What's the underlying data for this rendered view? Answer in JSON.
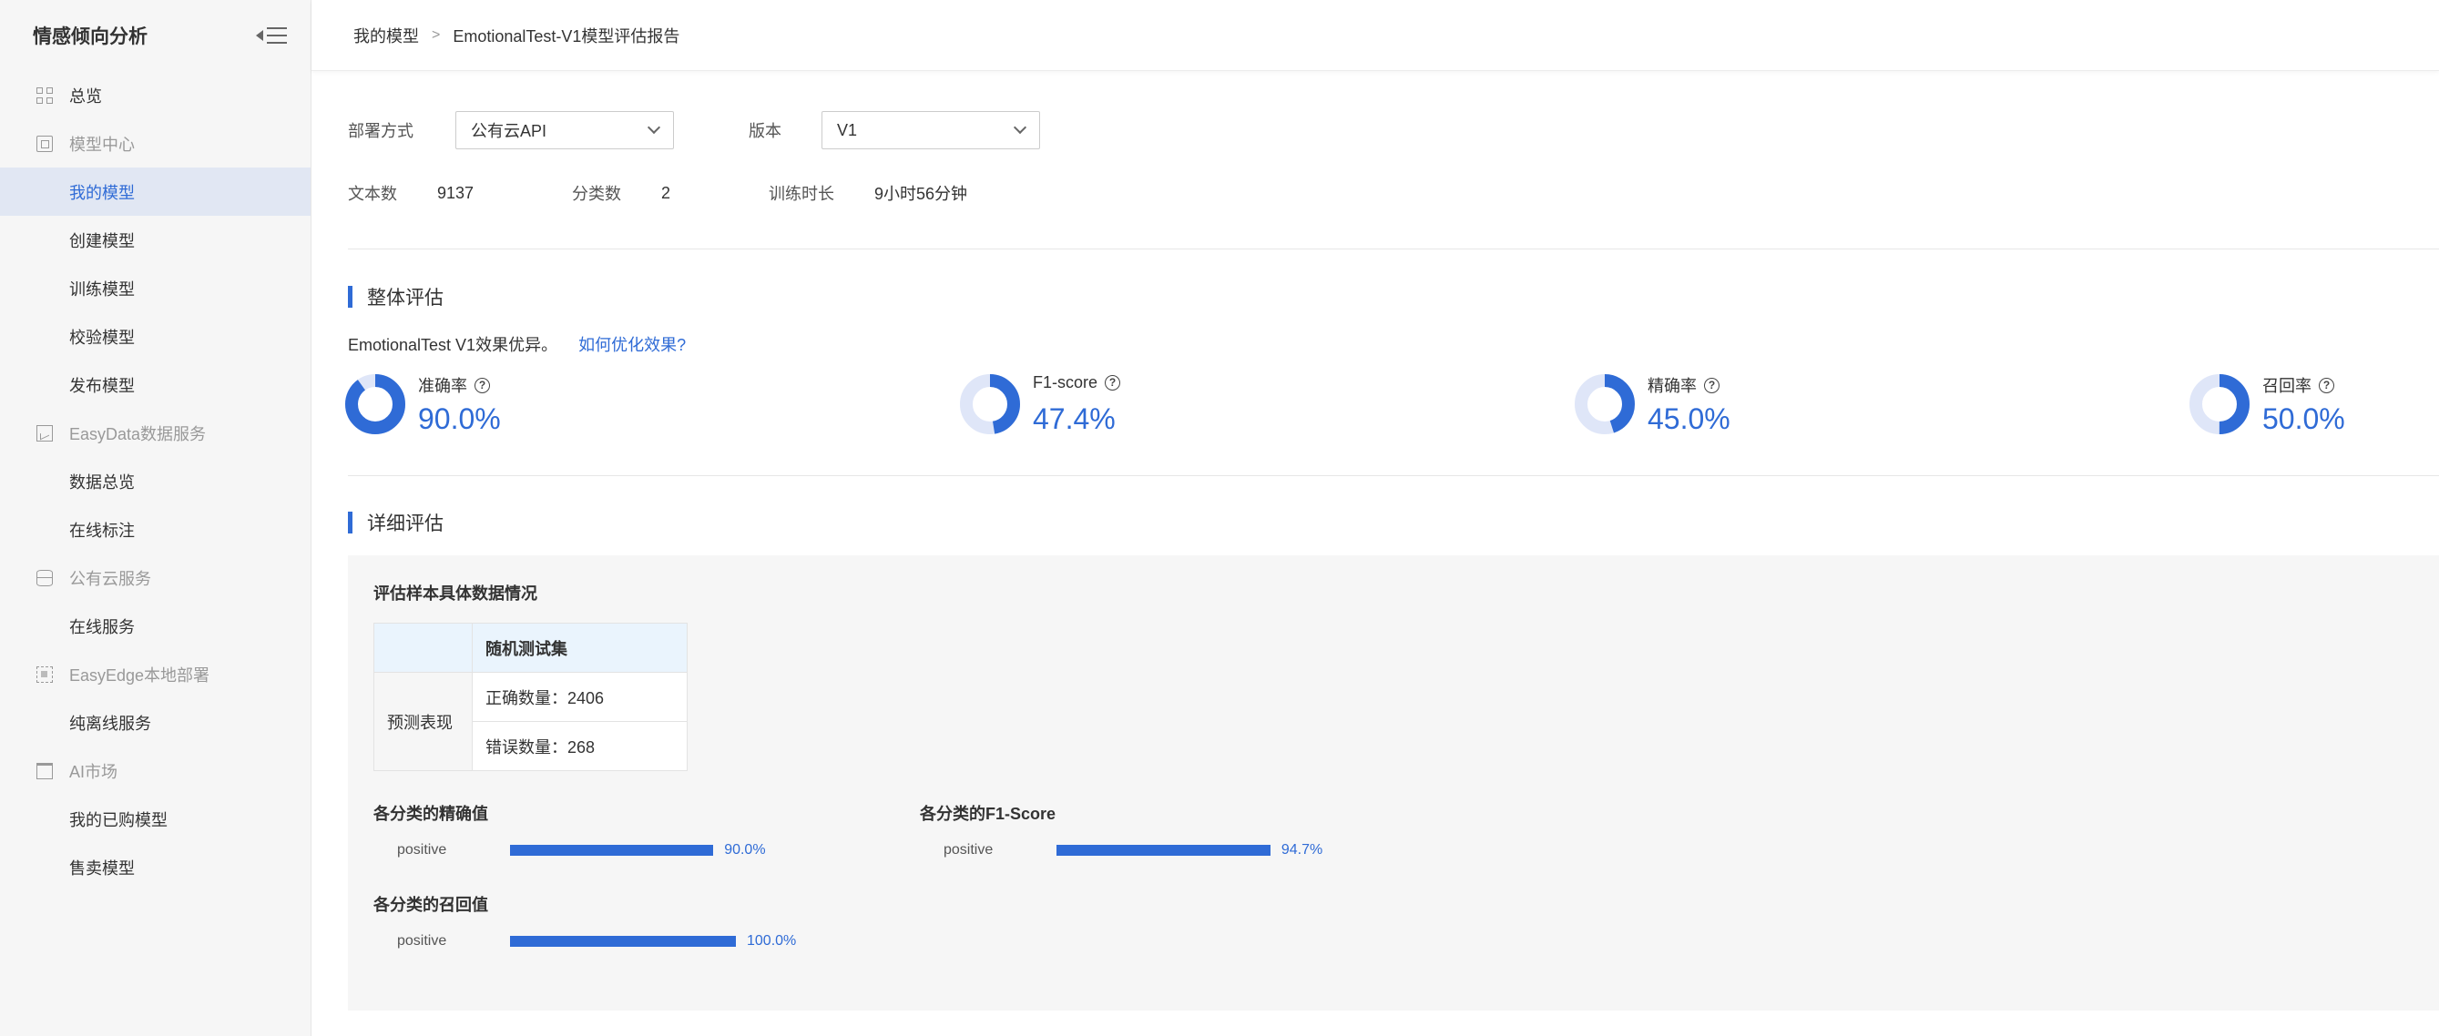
{
  "sidebar": {
    "title": "情感倾向分析",
    "overview": "总览",
    "groups": [
      {
        "label": "模型中心",
        "icon": "model-center-icon",
        "items": [
          "我的模型",
          "创建模型",
          "训练模型",
          "校验模型",
          "发布模型"
        ]
      },
      {
        "label": "EasyData数据服务",
        "icon": "chart-icon",
        "items": [
          "数据总览",
          "在线标注"
        ]
      },
      {
        "label": "公有云服务",
        "icon": "database-icon",
        "items": [
          "在线服务"
        ]
      },
      {
        "label": "EasyEdge本地部署",
        "icon": "edge-icon",
        "items": [
          "纯离线服务"
        ]
      },
      {
        "label": "AI市场",
        "icon": "shopping-bag-icon",
        "items": [
          "我的已购模型",
          "售卖模型"
        ]
      }
    ],
    "active_item": "我的模型"
  },
  "breadcrumb": {
    "parent": "我的模型",
    "current": "EmotionalTest-V1模型评估报告"
  },
  "filters": {
    "deploy_label": "部署方式",
    "deploy_value": "公有云API",
    "version_label": "版本",
    "version_value": "V1"
  },
  "stats": {
    "text_count_label": "文本数",
    "text_count_value": "9137",
    "class_count_label": "分类数",
    "class_count_value": "2",
    "train_time_label": "训练时长",
    "train_time_value": "9小时56分钟"
  },
  "overall": {
    "title": "整体评估",
    "desc": "EmotionalTest V1效果优异。",
    "link": "如何优化效果?",
    "metrics": [
      {
        "label": "准确率",
        "value": "90.0%",
        "fraction": 0.9
      },
      {
        "label": "F1-score",
        "value": "47.4%",
        "fraction": 0.474
      },
      {
        "label": "精确率",
        "value": "45.0%",
        "fraction": 0.45
      },
      {
        "label": "召回率",
        "value": "50.0%",
        "fraction": 0.5
      }
    ],
    "colors": {
      "accent": "#2f6bd6",
      "ring_bg": "#dfe6f8"
    }
  },
  "detail": {
    "title": "详细评估",
    "sample_title": "评估样本具体数据情况",
    "table": {
      "column_header": "随机测试集",
      "row_header": "预测表现",
      "correct": "正确数量：2406",
      "wrong": "错误数量：268"
    },
    "precision": {
      "title": "各分类的精确值",
      "category": "positive",
      "value": "90.0%",
      "fraction": 0.9
    },
    "f1": {
      "title": "各分类的F1-Score",
      "category": "positive",
      "value": "94.7%",
      "fraction": 0.947
    },
    "recall": {
      "title": "各分类的召回值",
      "category": "positive",
      "value": "100.0%",
      "fraction": 1.0
    }
  }
}
